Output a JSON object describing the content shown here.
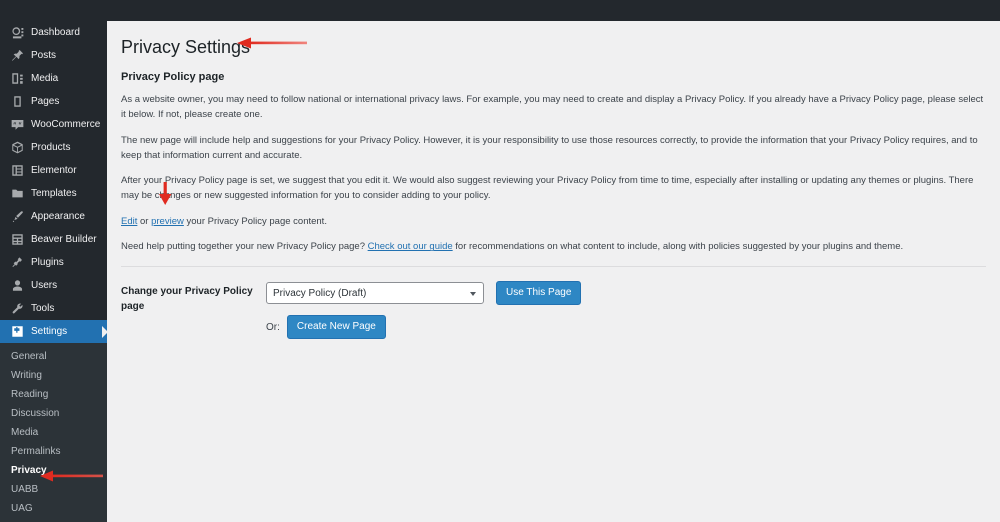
{
  "adminbar": {
    "logo_icon": "wordpress-logo-icon"
  },
  "sidebar": {
    "items": [
      {
        "label": "Dashboard",
        "icon": "dashboard-icon"
      },
      {
        "label": "Posts",
        "icon": "pin-icon"
      },
      {
        "label": "Media",
        "icon": "media-icon"
      },
      {
        "label": "Pages",
        "icon": "page-icon"
      },
      {
        "label": "WooCommerce",
        "icon": "woocommerce-icon"
      },
      {
        "label": "Products",
        "icon": "products-box-icon"
      },
      {
        "label": "Elementor",
        "icon": "elementor-icon"
      },
      {
        "label": "Templates",
        "icon": "folder-icon"
      },
      {
        "label": "Appearance",
        "icon": "paintbrush-icon"
      },
      {
        "label": "Beaver Builder",
        "icon": "grid-icon"
      },
      {
        "label": "Plugins",
        "icon": "plug-icon"
      },
      {
        "label": "Users",
        "icon": "user-icon"
      },
      {
        "label": "Tools",
        "icon": "wrench-icon"
      },
      {
        "label": "Settings",
        "icon": "settings-gear-icon",
        "current": true
      }
    ],
    "submenu": [
      {
        "label": "General"
      },
      {
        "label": "Writing"
      },
      {
        "label": "Reading"
      },
      {
        "label": "Discussion"
      },
      {
        "label": "Media"
      },
      {
        "label": "Permalinks"
      },
      {
        "label": "Privacy",
        "current": true
      },
      {
        "label": "UABB"
      },
      {
        "label": "UAG"
      }
    ]
  },
  "main": {
    "page_title": "Privacy Settings",
    "section_title": "Privacy Policy page",
    "paragraph_1": "As a website owner, you may need to follow national or international privacy laws. For example, you may need to create and display a Privacy Policy. If you already have a Privacy Policy page, please select it below. If not, please create one.",
    "paragraph_2": "The new page will include help and suggestions for your Privacy Policy. However, it is your responsibility to use those resources correctly, to provide the information that your Privacy Policy requires, and to keep that information current and accurate.",
    "paragraph_3": "After your Privacy Policy page is set, we suggest that you edit it. We would also suggest reviewing your Privacy Policy from time to time, especially after installing or updating any themes or plugins. There may be changes or new suggested information for you to consider adding to your policy.",
    "edit_link": "Edit",
    "edit_or": " or ",
    "preview_link": "preview",
    "edit_suffix": " your Privacy Policy page content.",
    "help_prefix": "Need help putting together your new Privacy Policy page? ",
    "help_link": "Check out our guide",
    "help_suffix": " for recommendations on what content to include, along with policies suggested by your plugins and theme.",
    "form": {
      "label": "Change your Privacy Policy page",
      "selected_page": "Privacy Policy (Draft)",
      "options": [
        "Privacy Policy (Draft)"
      ],
      "use_this_page_button": "Use This Page",
      "or_text": "Or:",
      "create_new_page_button": "Create New Page"
    }
  },
  "annotations": {
    "color": "#e02b20",
    "arrow_title": "arrow-pointing-to-page-title",
    "arrow_privacy": "arrow-pointing-to-privacy-menu",
    "arrow_preview": "arrow-pointing-to-preview-link"
  }
}
